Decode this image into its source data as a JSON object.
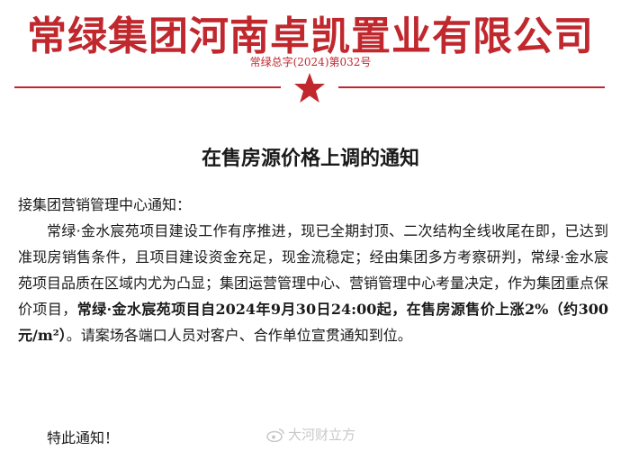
{
  "header": {
    "company": "常绿集团河南卓凯置业有限公司",
    "doc_number": "常绿总字(2024)第032号"
  },
  "notice": {
    "title": "在售房源价格上调的通知",
    "salutation": "接集团营销管理中心通知：",
    "paragraph_part1": "常绿·金水宸苑项目建设工作有序推进，现已全期封顶、二次结构全线收尾在即，已达到准现房销售条件，且项目建设资金充足，现金流稳定；经由集团多方考察研判，常绿·金水宸苑项目品质在区域内尤为凸显；集团运营管理中心、营销管理中心考量决定，作为集团重点保价项目，",
    "paragraph_bold1": "常绿·金水宸苑项目自2024年9月30日24:00起，在售房源售价上涨2%",
    "paragraph_bold2": "（约300元/m²）",
    "paragraph_part2": "。请案场各端口人员对客户、合作单位宣贯通知到位。",
    "closing": "特此通知！"
  },
  "watermark": {
    "text": "大河财立方"
  },
  "colors": {
    "brand_red": "#c0282e",
    "text": "#1a1a1a",
    "watermark": "#c8c8c8"
  }
}
